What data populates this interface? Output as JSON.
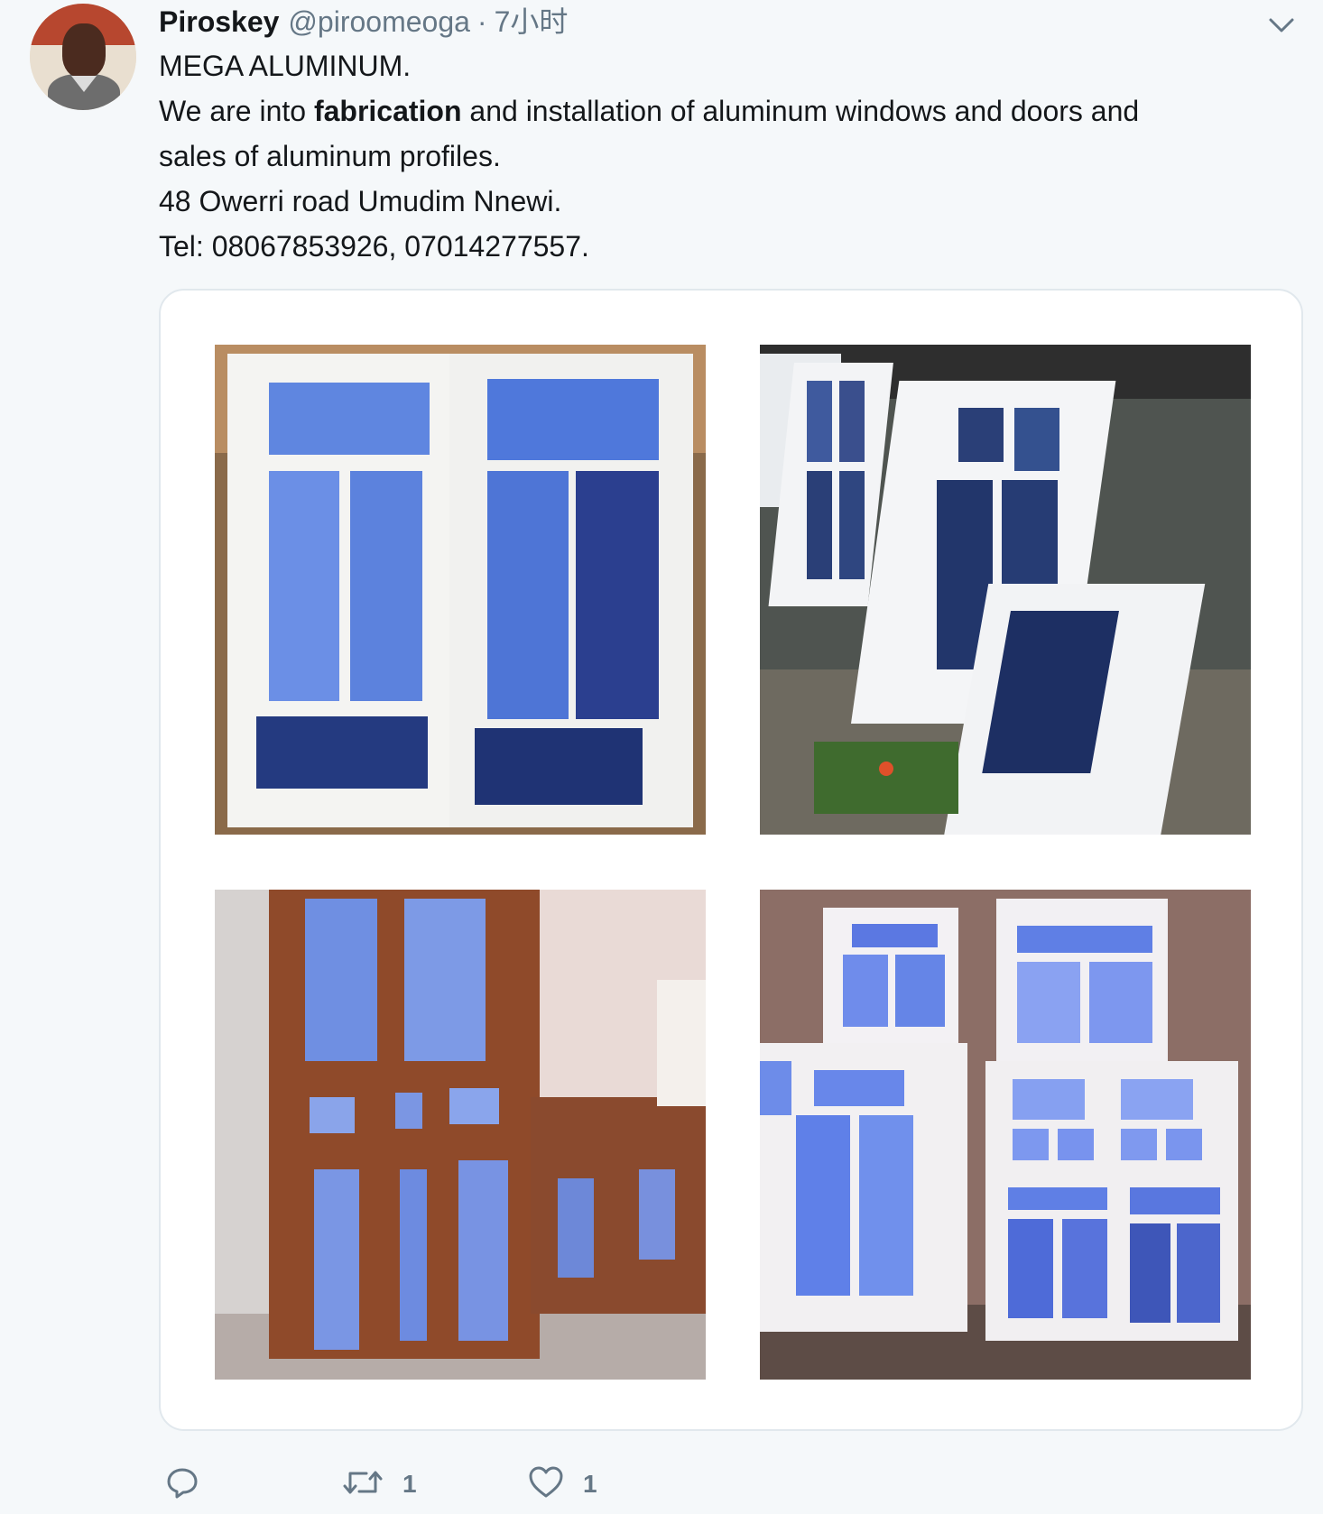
{
  "tweet": {
    "display_name": "Piroskey",
    "handle": "@piroomeoga",
    "separator": "·",
    "time": "7小时",
    "lines": {
      "line1": "MEGA ALUMINUM.",
      "line2_pre": "We are into ",
      "line2_bold": "fabrication",
      "line2_post": " and installation of aluminum windows and doors and",
      "line3": "sales of aluminum profiles.",
      "line4": "48 Owerri road Umudim Nnewi.",
      "line5": "Tel: 08067853926, 07014277557."
    }
  },
  "actions": {
    "reply_count": "",
    "retweet_count": "1",
    "like_count": "1"
  },
  "icons": {
    "more": "chevron-down-icon",
    "reply": "reply-icon",
    "retweet": "retweet-icon",
    "like": "heart-icon"
  },
  "colors": {
    "text": "#14171a",
    "secondary": "#657786",
    "background": "#f5f8fa",
    "border": "#e1e8ed"
  }
}
